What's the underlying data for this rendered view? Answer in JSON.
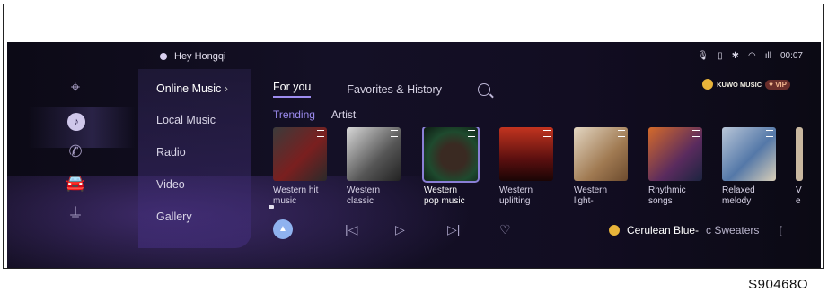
{
  "header": {
    "assistant_label": "Hey Hongqi",
    "time": "00:07"
  },
  "nav": {
    "items": [
      {
        "label": "Online Music"
      },
      {
        "label": "Local Music"
      },
      {
        "label": "Radio"
      },
      {
        "label": "Video"
      },
      {
        "label": "Gallery"
      }
    ]
  },
  "tabs": {
    "for_you": "For you",
    "favorites": "Favorites & History"
  },
  "brand": {
    "kuwo": "KUWO MUSIC",
    "vip": "VIP"
  },
  "subtabs": {
    "trending": "Trending",
    "artist": "Artist"
  },
  "cards": [
    {
      "line1": "Western hit",
      "line2": "music"
    },
    {
      "line1": "Western",
      "line2": "classic"
    },
    {
      "line1": "Western",
      "line2": "pop music"
    },
    {
      "line1": "Western",
      "line2": "uplifting"
    },
    {
      "line1": "Western",
      "line2": "light-"
    },
    {
      "line1": "Rhythmic",
      "line2": "songs"
    },
    {
      "line1": "Relaxed",
      "line2": "melody"
    },
    {
      "line1": "V",
      "line2": "e"
    }
  ],
  "now_playing": {
    "title": "Cerulean Blue-",
    "artist": "c Sweaters",
    "next": "[",
    "icon": "kuwo-logo"
  },
  "colors": {
    "accent": "#9d8cf0",
    "background": "#120d22"
  },
  "caption": "S90468O"
}
